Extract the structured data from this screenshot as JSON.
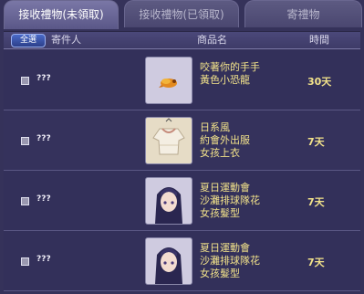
{
  "tabs": [
    {
      "label": "接收禮物(未領取)",
      "active": true
    },
    {
      "label": "接收禮物(已領取)",
      "active": false
    },
    {
      "label": "寄禮物",
      "active": false
    }
  ],
  "header": {
    "select_all": "全選",
    "sender": "寄件人",
    "item_name": "商品名",
    "time": "時間"
  },
  "rows": [
    {
      "sender": "???",
      "name_lines": [
        "咬著你的手手",
        "黃色小恐龍"
      ],
      "time": "30天",
      "icon": "yellow-dinosaur-icon"
    },
    {
      "sender": "???",
      "name_lines": [
        "日系風",
        "約會外出服",
        "女孩上衣"
      ],
      "time": "7天",
      "icon": "blouse-icon"
    },
    {
      "sender": "???",
      "name_lines": [
        "夏日運動會",
        "沙灘排球隊花",
        "女孩髮型"
      ],
      "time": "7天",
      "icon": "hairstyle-icon"
    },
    {
      "sender": "???",
      "name_lines": [
        "夏日運動會",
        "沙灘排球隊花",
        "女孩髮型"
      ],
      "time": "7天",
      "icon": "hairstyle-icon"
    }
  ]
}
